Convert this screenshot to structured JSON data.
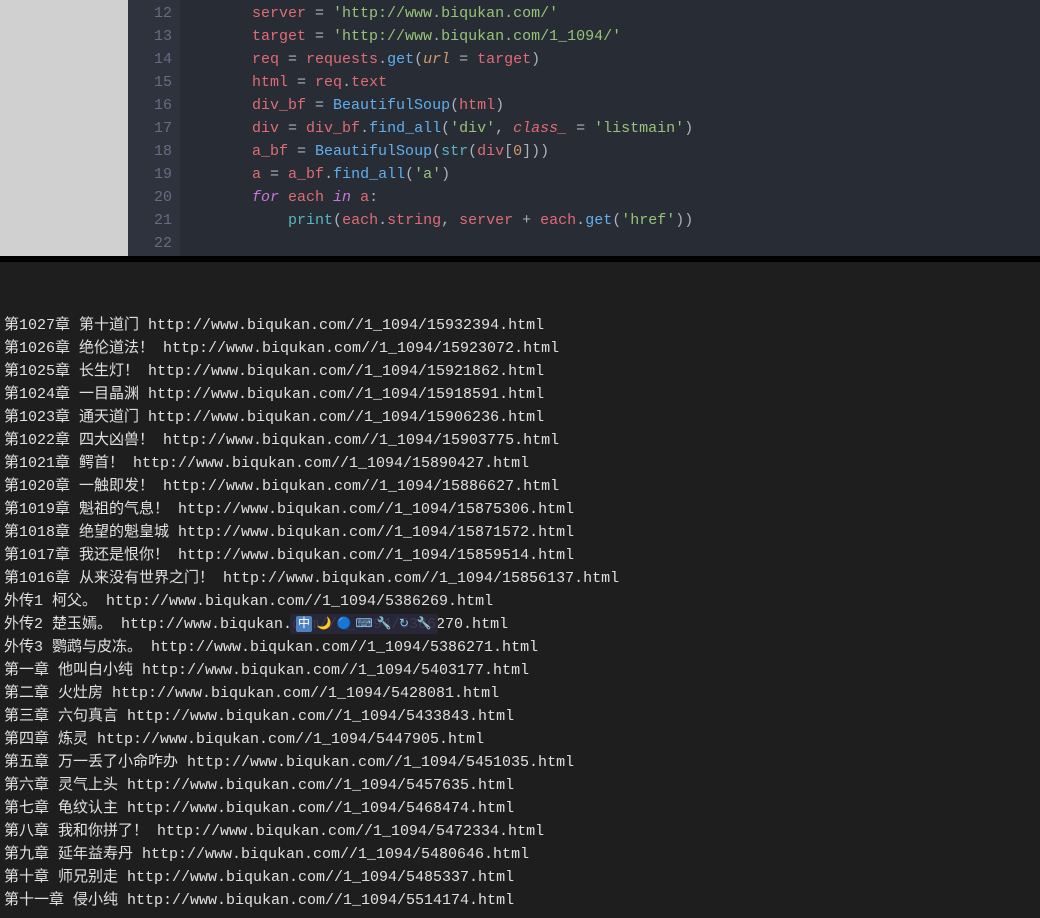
{
  "editor": {
    "line_numbers": [
      "12",
      "13",
      "14",
      "15",
      "16",
      "17",
      "18",
      "19",
      "20",
      "21",
      "22"
    ],
    "lines": [
      {
        "indent": "        ",
        "tokens": [
          {
            "t": "server ",
            "c": "tok-var"
          },
          {
            "t": "= ",
            "c": "tok-punct"
          },
          {
            "t": "'http://www.biqukan.com/'",
            "c": "tok-str"
          }
        ]
      },
      {
        "indent": "        ",
        "tokens": [
          {
            "t": "target ",
            "c": "tok-var"
          },
          {
            "t": "= ",
            "c": "tok-punct"
          },
          {
            "t": "'http://www.biqukan.com/1_1094/'",
            "c": "tok-str"
          }
        ]
      },
      {
        "indent": "        ",
        "tokens": [
          {
            "t": "req ",
            "c": "tok-var"
          },
          {
            "t": "= ",
            "c": "tok-punct"
          },
          {
            "t": "requests",
            "c": "tok-var"
          },
          {
            "t": ".",
            "c": "tok-punct"
          },
          {
            "t": "get",
            "c": "tok-func"
          },
          {
            "t": "(",
            "c": "tok-punct"
          },
          {
            "t": "url",
            "c": "tok-param"
          },
          {
            "t": " = ",
            "c": "tok-punct"
          },
          {
            "t": "target",
            "c": "tok-var"
          },
          {
            "t": ")",
            "c": "tok-punct"
          }
        ]
      },
      {
        "indent": "        ",
        "tokens": [
          {
            "t": "html ",
            "c": "tok-var"
          },
          {
            "t": "= ",
            "c": "tok-punct"
          },
          {
            "t": "req",
            "c": "tok-var"
          },
          {
            "t": ".",
            "c": "tok-punct"
          },
          {
            "t": "text",
            "c": "tok-var"
          }
        ]
      },
      {
        "indent": "        ",
        "tokens": [
          {
            "t": "div_bf ",
            "c": "tok-var"
          },
          {
            "t": "= ",
            "c": "tok-punct"
          },
          {
            "t": "BeautifulSoup",
            "c": "tok-func"
          },
          {
            "t": "(",
            "c": "tok-punct"
          },
          {
            "t": "html",
            "c": "tok-var"
          },
          {
            "t": ")",
            "c": "tok-punct"
          }
        ]
      },
      {
        "indent": "        ",
        "tokens": [
          {
            "t": "div ",
            "c": "tok-var"
          },
          {
            "t": "= ",
            "c": "tok-punct"
          },
          {
            "t": "div_bf",
            "c": "tok-var"
          },
          {
            "t": ".",
            "c": "tok-punct"
          },
          {
            "t": "find_all",
            "c": "tok-func"
          },
          {
            "t": "(",
            "c": "tok-punct"
          },
          {
            "t": "'div'",
            "c": "tok-str"
          },
          {
            "t": ", ",
            "c": "tok-punct"
          },
          {
            "t": "class_",
            "c": "tok-paramname"
          },
          {
            "t": " = ",
            "c": "tok-punct"
          },
          {
            "t": "'listmain'",
            "c": "tok-str"
          },
          {
            "t": ")",
            "c": "tok-punct"
          }
        ]
      },
      {
        "indent": "        ",
        "tokens": [
          {
            "t": "a_bf ",
            "c": "tok-var"
          },
          {
            "t": "= ",
            "c": "tok-punct"
          },
          {
            "t": "BeautifulSoup",
            "c": "tok-func"
          },
          {
            "t": "(",
            "c": "tok-punct"
          },
          {
            "t": "str",
            "c": "tok-builtin"
          },
          {
            "t": "(",
            "c": "tok-punct"
          },
          {
            "t": "div",
            "c": "tok-var"
          },
          {
            "t": "[",
            "c": "tok-punct"
          },
          {
            "t": "0",
            "c": "tok-num"
          },
          {
            "t": "]))",
            "c": "tok-punct"
          }
        ]
      },
      {
        "indent": "        ",
        "tokens": [
          {
            "t": "a ",
            "c": "tok-var"
          },
          {
            "t": "= ",
            "c": "tok-punct"
          },
          {
            "t": "a_bf",
            "c": "tok-var"
          },
          {
            "t": ".",
            "c": "tok-punct"
          },
          {
            "t": "find_all",
            "c": "tok-func"
          },
          {
            "t": "(",
            "c": "tok-punct"
          },
          {
            "t": "'a'",
            "c": "tok-str"
          },
          {
            "t": ")",
            "c": "tok-punct"
          }
        ]
      },
      {
        "indent": "        ",
        "tokens": [
          {
            "t": "for",
            "c": "tok-kw"
          },
          {
            "t": " each ",
            "c": "tok-var"
          },
          {
            "t": "in",
            "c": "tok-kw"
          },
          {
            "t": " a",
            "c": "tok-var"
          },
          {
            "t": ":",
            "c": "tok-punct"
          }
        ]
      },
      {
        "indent": "            ",
        "tokens": [
          {
            "t": "print",
            "c": "tok-builtin"
          },
          {
            "t": "(",
            "c": "tok-punct"
          },
          {
            "t": "each",
            "c": "tok-var"
          },
          {
            "t": ".",
            "c": "tok-punct"
          },
          {
            "t": "string",
            "c": "tok-var"
          },
          {
            "t": ", ",
            "c": "tok-punct"
          },
          {
            "t": "server ",
            "c": "tok-var"
          },
          {
            "t": "+ ",
            "c": "tok-punct"
          },
          {
            "t": "each",
            "c": "tok-var"
          },
          {
            "t": ".",
            "c": "tok-punct"
          },
          {
            "t": "get",
            "c": "tok-func"
          },
          {
            "t": "(",
            "c": "tok-punct"
          },
          {
            "t": "'href'",
            "c": "tok-str"
          },
          {
            "t": "))",
            "c": "tok-punct"
          }
        ]
      },
      {
        "indent": "        ",
        "tokens": []
      }
    ]
  },
  "console": {
    "lines": [
      "第1027章 第十道门 http://www.biqukan.com//1_1094/15932394.html",
      "第1026章 绝伦道法！ http://www.biqukan.com//1_1094/15923072.html",
      "第1025章 长生灯！ http://www.biqukan.com//1_1094/15921862.html",
      "第1024章 一目晶渊 http://www.biqukan.com//1_1094/15918591.html",
      "第1023章 通天道门 http://www.biqukan.com//1_1094/15906236.html",
      "第1022章 四大凶兽！ http://www.biqukan.com//1_1094/15903775.html",
      "第1021章 鳄首！ http://www.biqukan.com//1_1094/15890427.html",
      "第1020章 一触即发！ http://www.biqukan.com//1_1094/15886627.html",
      "第1019章 魁祖的气息！ http://www.biqukan.com//1_1094/15875306.html",
      "第1018章 绝望的魁皇城 http://www.biqukan.com//1_1094/15871572.html",
      "第1017章 我还是恨你！ http://www.biqukan.com//1_1094/15859514.html",
      "第1016章 从来没有世界之门！ http://www.biqukan.com//1_1094/15856137.html",
      "外传1 柯父。 http://www.biqukan.com//1_1094/5386269.html",
      "外传2 楚玉嫣。 http://www.biqukan.com//1_1094/5386270.html",
      "外传3 鹦鹉与皮冻。 http://www.biqukan.com//1_1094/5386271.html",
      "第一章 他叫白小纯 http://www.biqukan.com//1_1094/5403177.html",
      "第二章 火灶房 http://www.biqukan.com//1_1094/5428081.html",
      "第三章 六句真言 http://www.biqukan.com//1_1094/5433843.html",
      "第四章 炼灵 http://www.biqukan.com//1_1094/5447905.html",
      "第五章 万一丢了小命咋办 http://www.biqukan.com//1_1094/5451035.html",
      "第六章 灵气上头 http://www.biqukan.com//1_1094/5457635.html",
      "第七章 龟纹认主 http://www.biqukan.com//1_1094/5468474.html",
      "第八章 我和你拼了！ http://www.biqukan.com//1_1094/5472334.html",
      "第九章 延年益寿丹 http://www.biqukan.com//1_1094/5480646.html",
      "第十章 师兄别走 http://www.biqukan.com//1_1094/5485337.html",
      "第十一章 侵小纯 http://www.biqukan.com//1_1094/5514174.html"
    ]
  },
  "ime": {
    "items": [
      "中",
      "🌙",
      "🔵",
      "⌨",
      "🔧",
      "↻",
      "🔧"
    ]
  }
}
